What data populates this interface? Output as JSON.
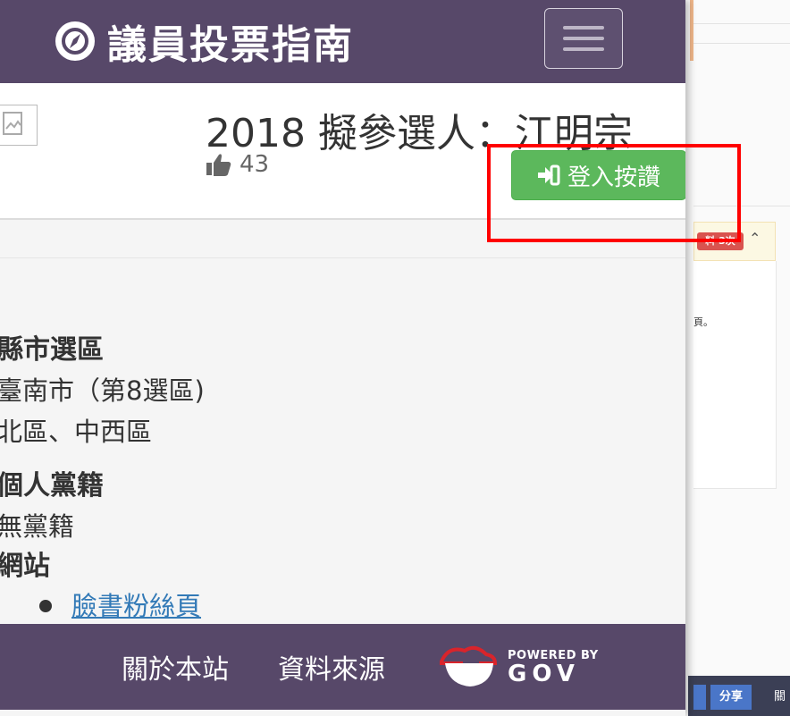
{
  "app": {
    "brand_title": "議員投票指南"
  },
  "header": {
    "title": "2018 擬參選人：江明宗",
    "likes_count": "43",
    "login_button_label": "登入按讚"
  },
  "content": {
    "district_heading": "縣市選區",
    "district_city": "臺南市（第8選區)",
    "district_area": "北區、中西區",
    "party_heading": "個人黨籍",
    "party_value": "無黨籍",
    "website_heading": "網站",
    "website_links": [
      "臉書粉絲頁"
    ]
  },
  "footer": {
    "about_label": "關於本站",
    "source_label": "資料來源",
    "powered_by": "POWERED BY",
    "gov_text": "GOV"
  },
  "background_page": {
    "badge_text": "料 3次",
    "snippet_text": "頁。",
    "share_button": "分享",
    "about_partial": "關"
  },
  "colors": {
    "navbar": "#574869",
    "login_button": "#5cb85c",
    "link": "#337ab7",
    "highlight": "#ff0000"
  },
  "icons": {
    "brand": "compass-icon",
    "likes": "thumbs-up-icon",
    "login": "sign-in-icon",
    "menu": "hamburger-icon"
  }
}
